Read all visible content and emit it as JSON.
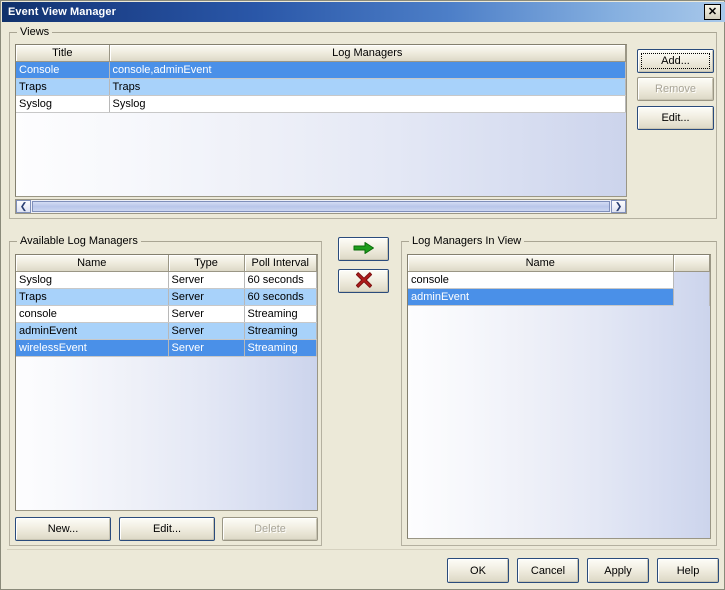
{
  "window": {
    "title": "Event View Manager",
    "close_icon": "close-icon",
    "close_glyph": "✕"
  },
  "views_group": {
    "label": "Views",
    "table": {
      "columns": [
        "Title",
        "Log Managers"
      ],
      "rows": [
        {
          "title": "Console",
          "log_managers": "console,adminEvent",
          "state": "selected"
        },
        {
          "title": "Traps",
          "log_managers": "Traps",
          "state": "stripe"
        },
        {
          "title": "Syslog",
          "log_managers": "Syslog",
          "state": "plain"
        }
      ]
    },
    "scrollbar": {
      "left_arrow_glyph": "❮",
      "right_arrow_glyph": "❯"
    },
    "buttons": [
      {
        "label": "Add...",
        "name": "add-view-button",
        "enabled": true,
        "focused": true
      },
      {
        "label": "Remove",
        "name": "remove-view-button",
        "enabled": false,
        "focused": false
      },
      {
        "label": "Edit...",
        "name": "edit-view-button",
        "enabled": true,
        "focused": false
      }
    ]
  },
  "available_group": {
    "label": "Available Log Managers",
    "table": {
      "columns": [
        "Name",
        "Type",
        "Poll Interval"
      ],
      "rows": [
        {
          "name": "Syslog",
          "type": "Server",
          "poll": "60 seconds",
          "state": "plain"
        },
        {
          "name": "Traps",
          "type": "Server",
          "poll": "60 seconds",
          "state": "stripe"
        },
        {
          "name": "console",
          "type": "Server",
          "poll": "Streaming",
          "state": "plain"
        },
        {
          "name": "adminEvent",
          "type": "Server",
          "poll": "Streaming",
          "state": "stripe"
        },
        {
          "name": "wirelessEvent",
          "type": "Server",
          "poll": "Streaming",
          "state": "selected"
        }
      ]
    },
    "buttons": [
      {
        "label": "New...",
        "name": "new-log-manager-button",
        "enabled": true
      },
      {
        "label": "Edit...",
        "name": "edit-log-manager-button",
        "enabled": true
      },
      {
        "label": "Delete",
        "name": "delete-log-manager-button",
        "enabled": false
      }
    ]
  },
  "transfer_buttons": [
    {
      "name": "add-to-view-button",
      "icon": "right-arrow-icon"
    },
    {
      "name": "remove-from-view-button",
      "icon": "red-x-icon"
    }
  ],
  "in_view_group": {
    "label": "Log Managers In View",
    "table": {
      "columns": [
        "Name"
      ],
      "rows": [
        {
          "name": "console",
          "state": "plain"
        },
        {
          "name": "adminEvent",
          "state": "selected"
        }
      ]
    }
  },
  "dialog_buttons": [
    {
      "label": "OK",
      "name": "ok-button"
    },
    {
      "label": "Cancel",
      "name": "cancel-button"
    },
    {
      "label": "Apply",
      "name": "apply-button"
    },
    {
      "label": "Help",
      "name": "help-button"
    }
  ],
  "colors": {
    "window_background": "#ece9d8",
    "title_bar_start": "#10316b",
    "title_bar_end": "#a8c8ea",
    "selection_blue": "#4a90e8",
    "stripe_blue": "#a8d2fa",
    "arrow_green": "#1d9e1d",
    "x_red": "#b01c1c"
  }
}
